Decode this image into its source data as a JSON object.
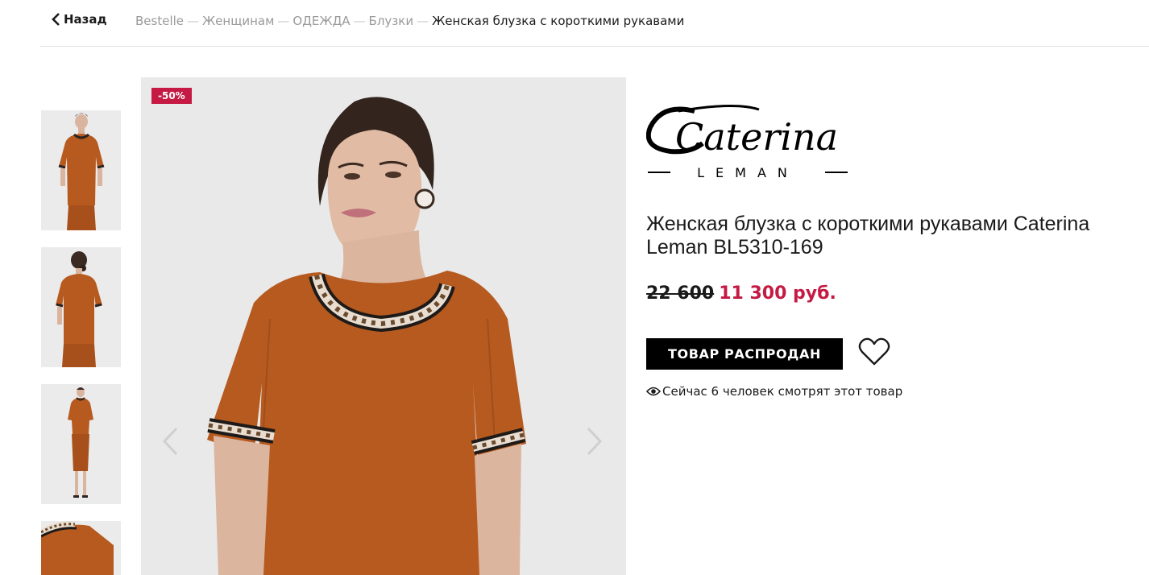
{
  "nav": {
    "back_label": "Назад",
    "back_icon": "chevron-left-icon"
  },
  "breadcrumb": {
    "separator": "—",
    "items": [
      "Bestelle",
      "Женщинам",
      "ОДЕЖДА",
      "Блузки"
    ],
    "current": "Женская блузка с короткими рукавами"
  },
  "gallery": {
    "thumbnails": [
      "front view",
      "back view",
      "full look front",
      "detail close-up"
    ],
    "discount_badge": "-50%",
    "prev_icon": "chevron-left-icon",
    "next_icon": "chevron-right-icon"
  },
  "brand": {
    "logo_text": "Caterina",
    "logo_subtext": "LEMAN"
  },
  "product": {
    "title": "Женская блузка с короткими рукавами Caterina Leman BL5310-169",
    "old_price": "22 600",
    "new_price": "11 300 руб.",
    "soldout_label": "ТОВАР РАСПРОДАН",
    "wishlist_icon": "heart-icon",
    "viewers_icon": "eye-icon",
    "viewers_text": "Сейчас 6 человек смотрят этот товар"
  },
  "colors": {
    "accent": "#c41a44",
    "blouse": "#b75a1f",
    "button": "#000000"
  }
}
